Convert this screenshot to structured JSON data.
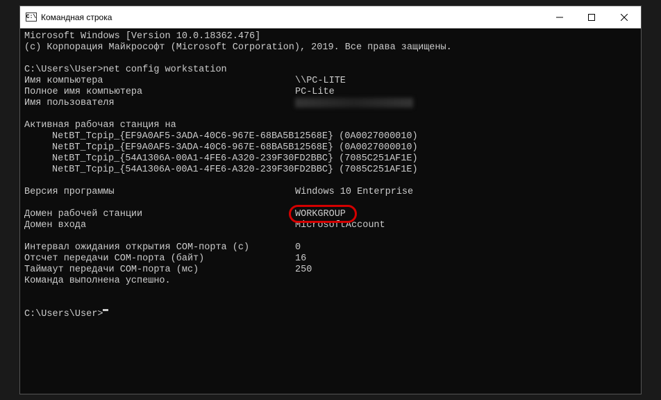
{
  "title": "Командная строка",
  "header": {
    "version": "Microsoft Windows [Version 10.0.18362.476]",
    "copyright": "(c) Корпорация Майкрософт (Microsoft Corporation), 2019. Все права защищены."
  },
  "prompt1": {
    "path": "C:\\Users\\User>",
    "command": "net config workstation"
  },
  "fields": {
    "computer_name_label": "Имя компьютера",
    "computer_name_value": "\\\\PC-LITE",
    "full_computer_name_label": "Полное имя компьютера",
    "full_computer_name_value": "PC-Lite",
    "username_label": "Имя пользователя",
    "active_workstation_label": "Активная рабочая станция на",
    "netbt1": "NetBT_Tcpip_{EF9A0AF5-3ADA-40C6-967E-68BA5B12568E} (0A0027000010)",
    "netbt2": "NetBT_Tcpip_{EF9A0AF5-3ADA-40C6-967E-68BA5B12568E} (0A0027000010)",
    "netbt3": "NetBT_Tcpip_{54A1306A-00A1-4FE6-A320-239F30FD2BBC} (7085C251AF1E)",
    "netbt4": "NetBT_Tcpip_{54A1306A-00A1-4FE6-A320-239F30FD2BBC} (7085C251AF1E)",
    "software_version_label": "Версия программы",
    "software_version_value": "Windows 10 Enterprise",
    "workstation_domain_label": "Домен рабочей станции",
    "workstation_domain_value": "WORKGROUP",
    "logon_domain_label": "Домен входа",
    "logon_domain_value": "MicrosoftAccount",
    "com_open_timeout_label": "Интервал ожидания открытия COM-порта (с)",
    "com_open_timeout_value": "0",
    "com_send_count_label": "Отсчет передачи COM-порта (байт)",
    "com_send_count_value": "16",
    "com_send_timeout_label": "Таймаут передачи COM-порта (мс)",
    "com_send_timeout_value": "250",
    "success": "Команда выполнена успешно."
  },
  "prompt2": {
    "path": "C:\\Users\\User>"
  }
}
